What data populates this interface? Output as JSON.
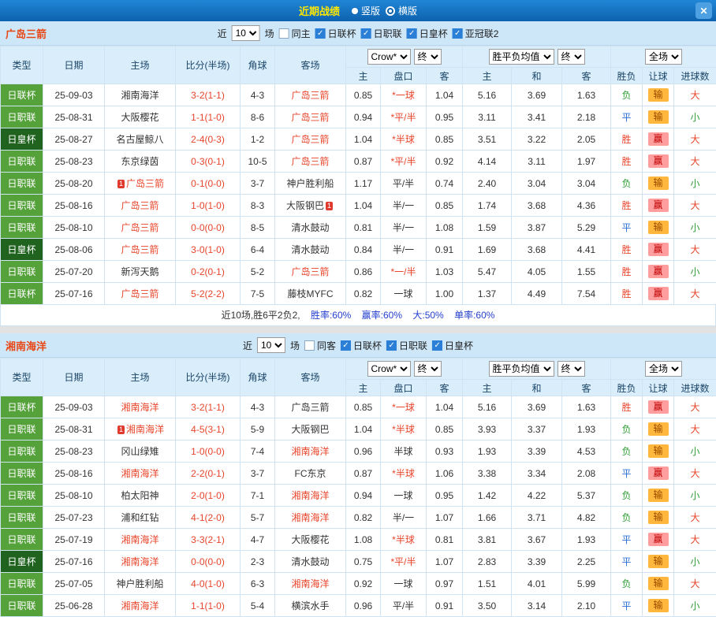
{
  "topbar": {
    "title": "近期战绩",
    "layout_options": {
      "vertical": "竖版",
      "horizontal": "横版",
      "selected": "横版"
    }
  },
  "labels": {
    "near": "近",
    "matches": "场"
  },
  "cols": {
    "type": "类型",
    "date": "日期",
    "home": "主场",
    "score": "比分(半场)",
    "corner": "角球",
    "away": "客场",
    "asian_source": "Crow*",
    "final": "终",
    "euro_source": "胜平负均值",
    "scope": "全场",
    "asian_home": "主",
    "handicap": "盘口",
    "asian_away": "客",
    "euro_home": "主",
    "euro_draw": "和",
    "euro_away": "客",
    "result": "胜负",
    "let_result": "让球",
    "goals": "进球数"
  },
  "colors": {
    "topbar_blue": "#0d62ae",
    "accent_red": "#e8442a",
    "type_green": "#55a13a",
    "type_dark_green": "#20631f",
    "draw_blue": "#2b6fd6",
    "loss_green": "#2e9e36",
    "let_win_bg": "#ff9e9e",
    "let_loss_bg": "#ffb73d",
    "stat_blue": "#2440cc",
    "section_head_bg": "#cde7f8"
  },
  "sections": [
    {
      "team": "广岛三箭",
      "filter": {
        "count": "10",
        "same_label": "同主",
        "same_checked": false,
        "competitions": [
          "日联杯",
          "日职联",
          "日皇杯",
          "亚冠联2"
        ]
      },
      "rows": [
        {
          "type": "日联杯",
          "date": "25-09-03",
          "home": "湘南海洋",
          "score": "3-2(1-1)",
          "corner": "4-3",
          "away": "广岛三箭",
          "away_focus": true,
          "ah": "0.85",
          "hc": "*一球",
          "aa": "1.04",
          "eh": "5.16",
          "ed": "3.69",
          "ea": "1.63",
          "res": "负",
          "let": "输",
          "goal": "大"
        },
        {
          "type": "日职联",
          "date": "25-08-31",
          "home": "大阪樱花",
          "score": "1-1(1-0)",
          "corner": "8-6",
          "away": "广岛三箭",
          "away_focus": true,
          "ah": "0.94",
          "hc": "*平/半",
          "aa": "0.95",
          "eh": "3.11",
          "ed": "3.41",
          "ea": "2.18",
          "res": "平",
          "let": "输",
          "goal": "小"
        },
        {
          "type": "日皇杯",
          "dark": true,
          "date": "25-08-27",
          "home": "名古屋鲸八",
          "score": "2-4(0-3)",
          "corner": "1-2",
          "away": "广岛三箭",
          "away_focus": true,
          "ah": "1.04",
          "hc": "*半球",
          "aa": "0.85",
          "eh": "3.51",
          "ed": "3.22",
          "ea": "2.05",
          "res": "胜",
          "let": "赢",
          "goal": "大"
        },
        {
          "type": "日职联",
          "date": "25-08-23",
          "home": "东京绿茵",
          "score": "0-3(0-1)",
          "corner": "10-5",
          "away": "广岛三箭",
          "away_focus": true,
          "ah": "0.87",
          "hc": "*平/半",
          "aa": "0.92",
          "eh": "4.14",
          "ed": "3.11",
          "ea": "1.97",
          "res": "胜",
          "let": "赢",
          "goal": "大"
        },
        {
          "type": "日职联",
          "date": "25-08-20",
          "home": "广岛三箭",
          "home_focus": true,
          "home_badge": "1",
          "score": "0-1(0-0)",
          "corner": "3-7",
          "away": "神户胜利船",
          "ah": "1.17",
          "hc": "平/半",
          "aa": "0.74",
          "eh": "2.40",
          "ed": "3.04",
          "ea": "3.04",
          "res": "负",
          "let": "输",
          "goal": "小"
        },
        {
          "type": "日职联",
          "date": "25-08-16",
          "home": "广岛三箭",
          "home_focus": true,
          "score": "1-0(1-0)",
          "corner": "8-3",
          "away": "大阪钢巴",
          "away_badge": "1",
          "ah": "1.04",
          "hc": "半/一",
          "aa": "0.85",
          "eh": "1.74",
          "ed": "3.68",
          "ea": "4.36",
          "res": "胜",
          "let": "赢",
          "goal": "大"
        },
        {
          "type": "日职联",
          "date": "25-08-10",
          "home": "广岛三箭",
          "home_focus": true,
          "score": "0-0(0-0)",
          "corner": "8-5",
          "away": "清水鼓动",
          "ah": "0.81",
          "hc": "半/一",
          "aa": "1.08",
          "eh": "1.59",
          "ed": "3.87",
          "ea": "5.29",
          "res": "平",
          "let": "输",
          "goal": "小"
        },
        {
          "type": "日皇杯",
          "dark": true,
          "date": "25-08-06",
          "home": "广岛三箭",
          "home_focus": true,
          "score": "3-0(1-0)",
          "corner": "6-4",
          "away": "清水鼓动",
          "ah": "0.84",
          "hc": "半/一",
          "aa": "0.91",
          "eh": "1.69",
          "ed": "3.68",
          "ea": "4.41",
          "res": "胜",
          "let": "赢",
          "goal": "大"
        },
        {
          "type": "日职联",
          "date": "25-07-20",
          "home": "新泻天鹅",
          "score": "0-2(0-1)",
          "corner": "5-2",
          "away": "广岛三箭",
          "away_focus": true,
          "ah": "0.86",
          "hc": "*一/半",
          "aa": "1.03",
          "eh": "5.47",
          "ed": "4.05",
          "ea": "1.55",
          "res": "胜",
          "let": "赢",
          "goal": "小"
        },
        {
          "type": "日联杯",
          "date": "25-07-16",
          "home": "广岛三箭",
          "home_focus": true,
          "score": "5-2(2-2)",
          "corner": "7-5",
          "away": "藤枝MYFC",
          "ah": "0.82",
          "hc": "一球",
          "aa": "1.00",
          "eh": "1.37",
          "ed": "4.49",
          "ea": "7.54",
          "res": "胜",
          "let": "赢",
          "goal": "大"
        }
      ],
      "footer": {
        "summary": "近10场,胜6平2负2,",
        "stats": [
          "胜率:60%",
          "赢率:60%",
          "大:50%",
          "单率:60%"
        ]
      }
    },
    {
      "team": "湘南海洋",
      "filter": {
        "count": "10",
        "same_label": "同客",
        "same_checked": false,
        "competitions": [
          "日联杯",
          "日职联",
          "日皇杯"
        ]
      },
      "rows": [
        {
          "type": "日联杯",
          "date": "25-09-03",
          "home": "湘南海洋",
          "home_focus": true,
          "score": "3-2(1-1)",
          "corner": "4-3",
          "away": "广岛三箭",
          "ah": "0.85",
          "hc": "*一球",
          "aa": "1.04",
          "eh": "5.16",
          "ed": "3.69",
          "ea": "1.63",
          "res": "胜",
          "let": "赢",
          "goal": "大"
        },
        {
          "type": "日职联",
          "date": "25-08-31",
          "home": "湘南海洋",
          "home_focus": true,
          "home_badge": "1",
          "score": "4-5(3-1)",
          "corner": "5-9",
          "away": "大阪钢巴",
          "ah": "1.04",
          "hc": "*半球",
          "aa": "0.85",
          "eh": "3.93",
          "ed": "3.37",
          "ea": "1.93",
          "res": "负",
          "let": "输",
          "goal": "大"
        },
        {
          "type": "日职联",
          "date": "25-08-23",
          "home": "冈山绿雉",
          "score": "1-0(0-0)",
          "corner": "7-4",
          "away": "湘南海洋",
          "away_focus": true,
          "ah": "0.96",
          "hc": "半球",
          "aa": "0.93",
          "eh": "1.93",
          "ed": "3.39",
          "ea": "4.53",
          "res": "负",
          "let": "输",
          "goal": "小"
        },
        {
          "type": "日职联",
          "date": "25-08-16",
          "home": "湘南海洋",
          "home_focus": true,
          "score": "2-2(0-1)",
          "corner": "3-7",
          "away": "FC东京",
          "ah": "0.87",
          "hc": "*半球",
          "aa": "1.06",
          "eh": "3.38",
          "ed": "3.34",
          "ea": "2.08",
          "res": "平",
          "let": "赢",
          "goal": "大"
        },
        {
          "type": "日职联",
          "date": "25-08-10",
          "home": "柏太阳神",
          "score": "2-0(1-0)",
          "corner": "7-1",
          "away": "湘南海洋",
          "away_focus": true,
          "ah": "0.94",
          "hc": "一球",
          "aa": "0.95",
          "eh": "1.42",
          "ed": "4.22",
          "ea": "5.37",
          "res": "负",
          "let": "输",
          "goal": "小"
        },
        {
          "type": "日职联",
          "date": "25-07-23",
          "home": "浦和红钻",
          "score": "4-1(2-0)",
          "corner": "5-7",
          "away": "湘南海洋",
          "away_focus": true,
          "ah": "0.82",
          "hc": "半/一",
          "aa": "1.07",
          "eh": "1.66",
          "ed": "3.71",
          "ea": "4.82",
          "res": "负",
          "let": "输",
          "goal": "大"
        },
        {
          "type": "日职联",
          "date": "25-07-19",
          "home": "湘南海洋",
          "home_focus": true,
          "score": "3-3(2-1)",
          "corner": "4-7",
          "away": "大阪樱花",
          "ah": "1.08",
          "hc": "*半球",
          "aa": "0.81",
          "eh": "3.81",
          "ed": "3.67",
          "ea": "1.93",
          "res": "平",
          "let": "赢",
          "goal": "大"
        },
        {
          "type": "日皇杯",
          "dark": true,
          "date": "25-07-16",
          "home": "湘南海洋",
          "home_focus": true,
          "score": "0-0(0-0)",
          "corner": "2-3",
          "away": "清水鼓动",
          "ah": "0.75",
          "hc": "*平/半",
          "aa": "1.07",
          "eh": "2.83",
          "ed": "3.39",
          "ea": "2.25",
          "res": "平",
          "let": "输",
          "goal": "小"
        },
        {
          "type": "日职联",
          "date": "25-07-05",
          "home": "神户胜利船",
          "score": "4-0(1-0)",
          "corner": "6-3",
          "away": "湘南海洋",
          "away_focus": true,
          "ah": "0.92",
          "hc": "一球",
          "aa": "0.97",
          "eh": "1.51",
          "ed": "4.01",
          "ea": "5.99",
          "res": "负",
          "let": "输",
          "goal": "大"
        },
        {
          "type": "日职联",
          "date": "25-06-28",
          "home": "湘南海洋",
          "home_focus": true,
          "score": "1-1(1-0)",
          "corner": "5-4",
          "away": "横滨水手",
          "ah": "0.96",
          "hc": "平/半",
          "aa": "0.91",
          "eh": "3.50",
          "ed": "3.14",
          "ea": "2.10",
          "res": "平",
          "let": "输",
          "goal": "小"
        }
      ]
    }
  ]
}
